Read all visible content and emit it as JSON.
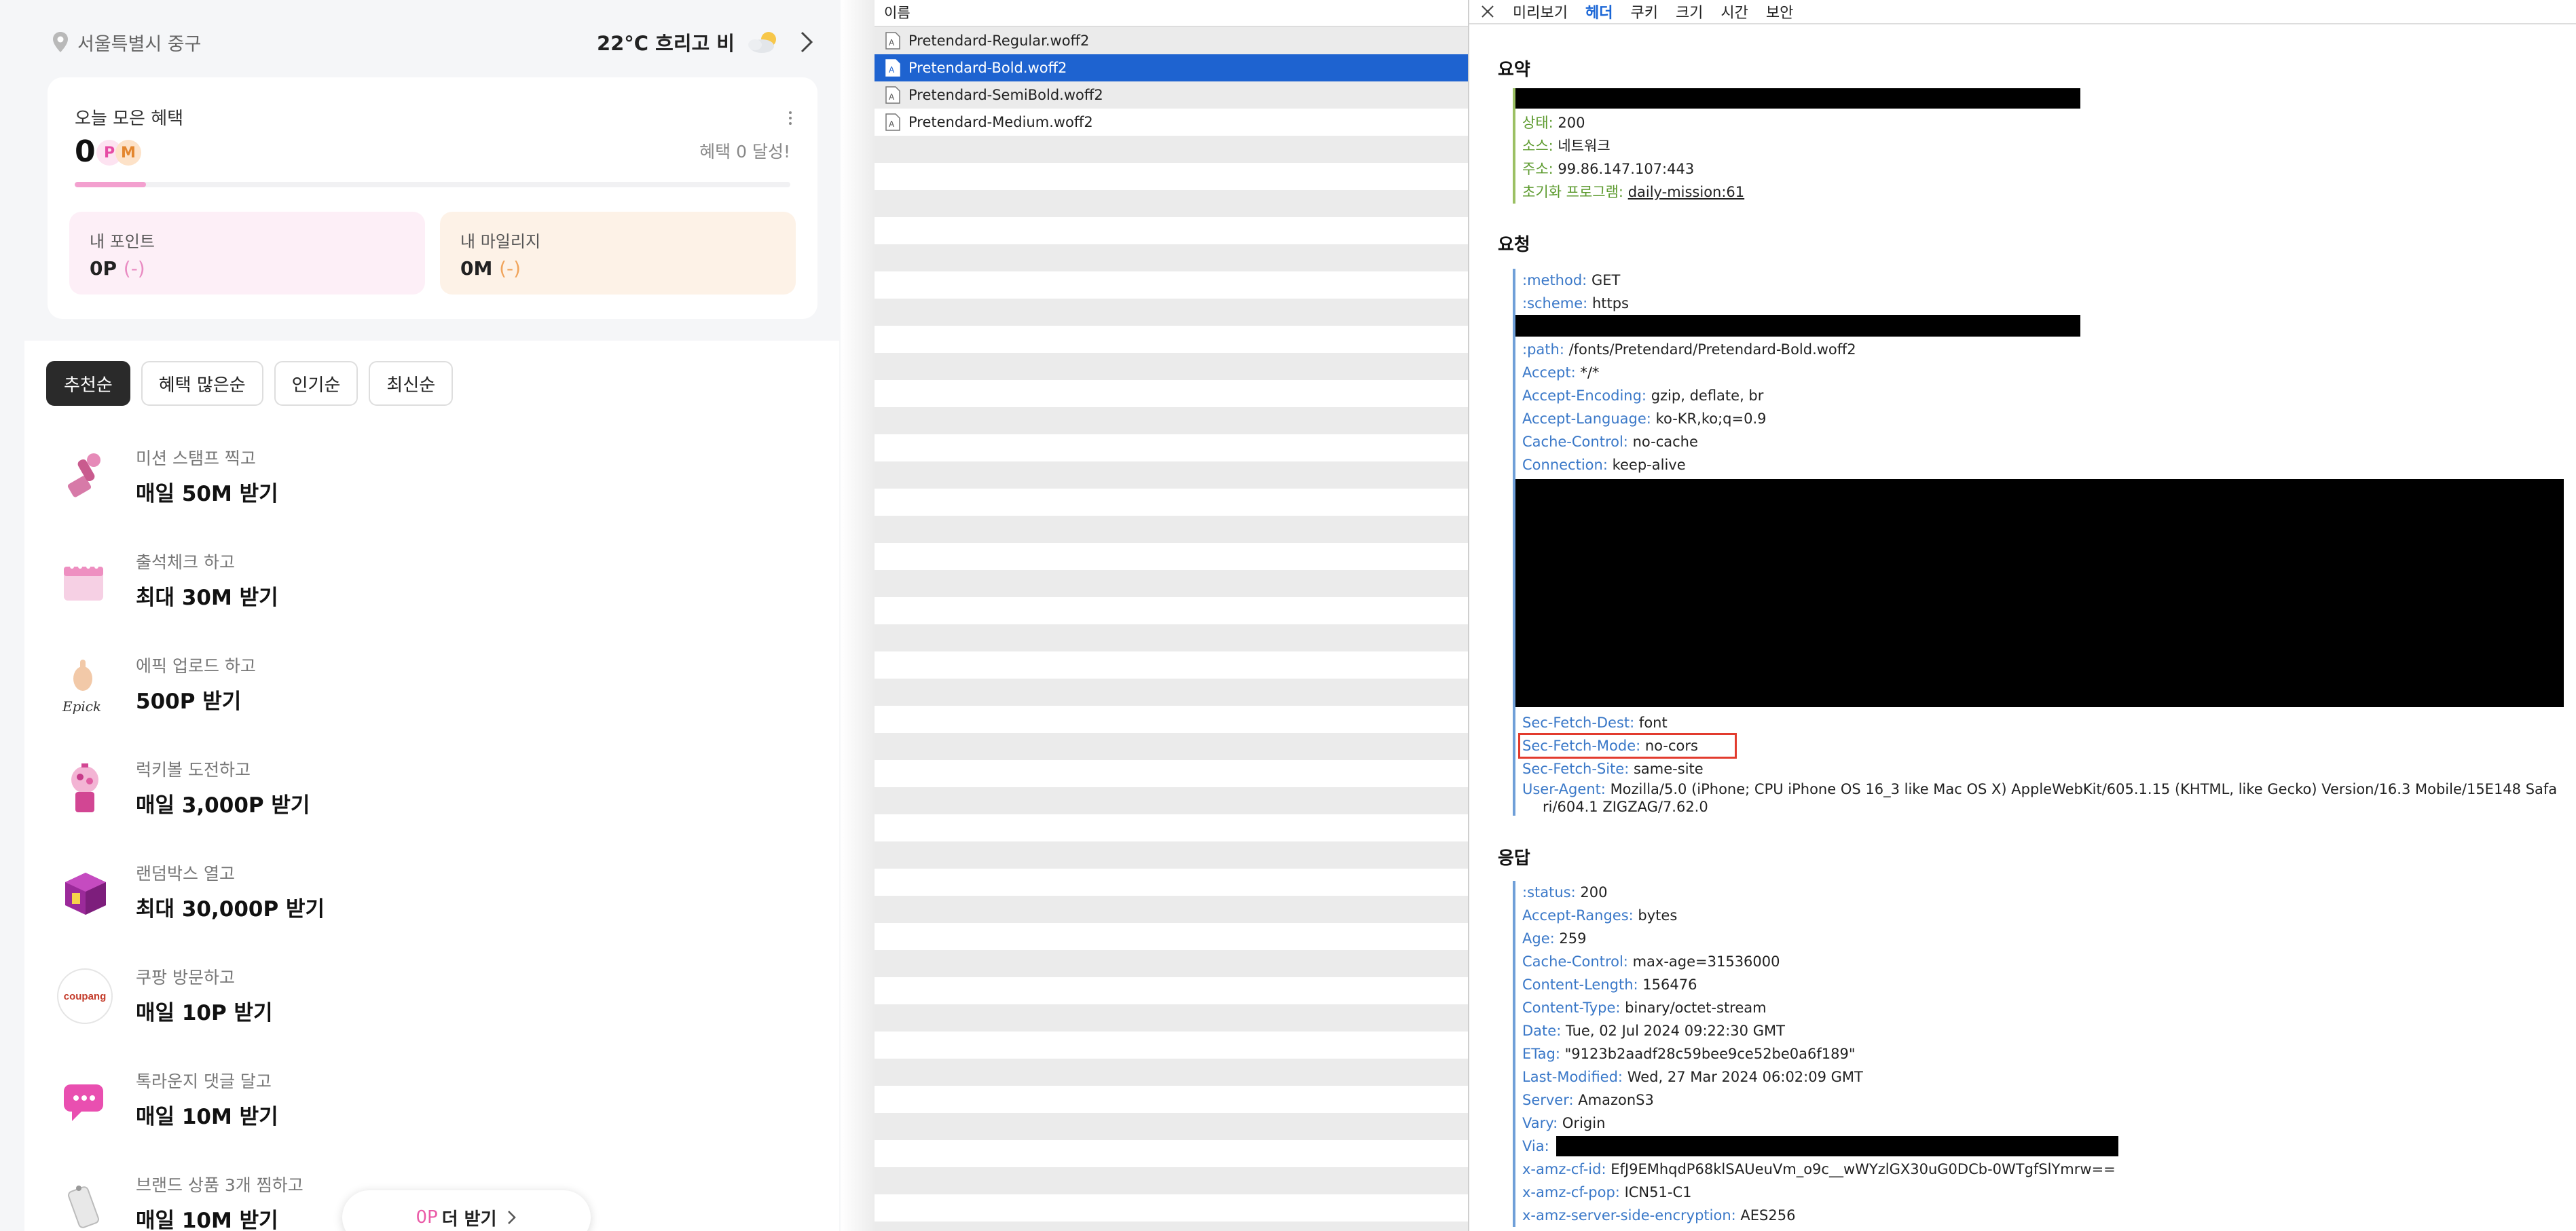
{
  "app": {
    "location": "서울특별시 중구",
    "weather": "22°C 흐리고 비",
    "benefit_card": {
      "title": "오늘 모은 혜택",
      "count": "0",
      "badge_p": "P",
      "badge_m": "M",
      "achieve": "혜택 0 달성!",
      "progress": 0.1,
      "point_label": "내 포인트",
      "point_value": "0P",
      "point_delta": "(-)",
      "mileage_label": "내 마일리지",
      "mileage_value": "0M",
      "mileage_delta": "(-)"
    },
    "sort_tabs": [
      "추천순",
      "혜택 많은순",
      "인기순",
      "최신순"
    ],
    "missions": [
      {
        "sub": "미션 스탬프 찍고",
        "main": "매일 50M 받기",
        "icon": "stamp-icon"
      },
      {
        "sub": "출석체크 하고",
        "main": "최대 30M 받기",
        "icon": "calendar-icon"
      },
      {
        "sub": "에픽 업로드 하고",
        "main": "500P 받기",
        "icon": "epick-hand-icon",
        "icon_text": "Epick"
      },
      {
        "sub": "럭키볼 도전하고",
        "main": "매일 3,000P 받기",
        "icon": "gumball-machine-icon"
      },
      {
        "sub": "랜덤박스 열고",
        "main": "최대 30,000P 받기",
        "icon": "random-box-icon"
      },
      {
        "sub": "쿠팡 방문하고",
        "main": "매일 10P 받기",
        "icon": "coupang-logo-icon",
        "icon_text": "coupang"
      },
      {
        "sub": "톡라운지 댓글 달고",
        "main": "매일 10M 받기",
        "icon": "chat-bubble-icon"
      },
      {
        "sub": "브랜드 상품 3개 찜하고",
        "main": "매일 10M 받기",
        "icon": "tag-icon"
      }
    ],
    "bottom_button": {
      "prefix": "0P",
      "label": "더 받기"
    }
  },
  "files": {
    "header": "이름",
    "items": [
      {
        "name": "Pretendard-Regular.woff2",
        "selected": false
      },
      {
        "name": "Pretendard-Bold.woff2",
        "selected": true
      },
      {
        "name": "Pretendard-SemiBold.woff2",
        "selected": false
      },
      {
        "name": "Pretendard-Medium.woff2",
        "selected": false
      }
    ]
  },
  "detail": {
    "tabs": [
      "미리보기",
      "헤더",
      "쿠키",
      "크기",
      "시간",
      "보안"
    ],
    "active_tab": "헤더",
    "summary_title": "요약",
    "summary": [
      {
        "k": "상태:",
        "v": "200"
      },
      {
        "k": "소스:",
        "v": "네트워크"
      },
      {
        "k": "주소:",
        "v": "99.86.147.107:443"
      },
      {
        "k": "초기화 프로그램:",
        "v": "daily-mission:61"
      }
    ],
    "request_title": "요청",
    "request_top": [
      {
        "k": ":method:",
        "v": "GET"
      },
      {
        "k": ":scheme:",
        "v": "https"
      }
    ],
    "request_mid": [
      {
        "k": ":path:",
        "v": "/fonts/Pretendard/Pretendard-Bold.woff2"
      },
      {
        "k": "Accept:",
        "v": "*/*"
      },
      {
        "k": "Accept-Encoding:",
        "v": "gzip, deflate, br"
      },
      {
        "k": "Accept-Language:",
        "v": "ko-KR,ko;q=0.9"
      },
      {
        "k": "Cache-Control:",
        "v": "no-cache"
      },
      {
        "k": "Connection:",
        "v": "keep-alive"
      }
    ],
    "request_bottom": [
      {
        "k": "Sec-Fetch-Dest:",
        "v": "font"
      },
      {
        "k": "Sec-Fetch-Mode:",
        "v": "no-cors"
      },
      {
        "k": "Sec-Fetch-Site:",
        "v": "same-site"
      },
      {
        "k": "User-Agent:",
        "v": "Mozilla/5.0 (iPhone; CPU iPhone OS 16_3 like Mac OS X) AppleWebKit/605.1.15 (KHTML, like Gecko) Version/16.3 Mobile/15E148 Safa"
      }
    ],
    "ua_wrap": "ri/604.1 ZIGZAG/7.62.0",
    "response_title": "응답",
    "response": [
      {
        "k": ":status:",
        "v": "200"
      },
      {
        "k": "Accept-Ranges:",
        "v": "bytes"
      },
      {
        "k": "Age:",
        "v": "259"
      },
      {
        "k": "Cache-Control:",
        "v": "max-age=31536000"
      },
      {
        "k": "Content-Length:",
        "v": "156476"
      },
      {
        "k": "Content-Type:",
        "v": "binary/octet-stream"
      },
      {
        "k": "Date:",
        "v": "Tue, 02 Jul 2024 09:22:30 GMT"
      },
      {
        "k": "ETag:",
        "v": "\"9123b2aadf28c59bee9ce52be0a6f189\""
      },
      {
        "k": "Last-Modified:",
        "v": "Wed, 27 Mar 2024 06:02:09 GMT"
      },
      {
        "k": "Server:",
        "v": "AmazonS3"
      },
      {
        "k": "Vary:",
        "v": "Origin"
      },
      {
        "k": "Via:",
        "v": ""
      },
      {
        "k": "x-amz-cf-id:",
        "v": "EfJ9EMhqdP68klSAUeuVm_o9c__wWYzlGX30uG0DCb-0WTgfSlYmrw=="
      },
      {
        "k": "x-amz-cf-pop:",
        "v": "ICN51-C1"
      },
      {
        "k": "x-amz-server-side-encryption:",
        "v": "AES256"
      }
    ],
    "colors": {
      "selection": "#1e63d0",
      "highlight": "#e23b2e",
      "key": "#3a78c8",
      "summary_key": "#5c9a2e"
    }
  }
}
